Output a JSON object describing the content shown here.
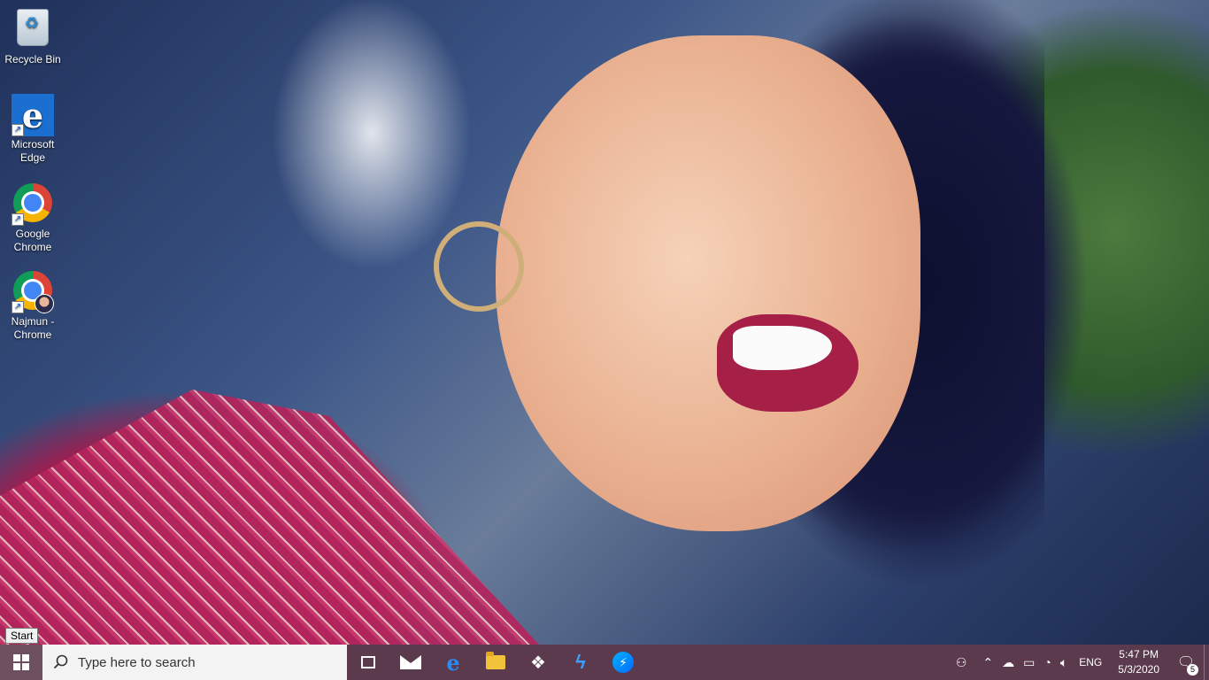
{
  "desktop": {
    "icons": [
      {
        "label": "Recycle Bin",
        "icon": "recycle-bin-icon"
      },
      {
        "label": "Microsoft Edge",
        "icon": "edge-icon"
      },
      {
        "label": "Google Chrome",
        "icon": "chrome-icon"
      },
      {
        "label": "Najmun - Chrome",
        "icon": "chrome-profile-icon"
      }
    ]
  },
  "tooltip": {
    "text": "Start"
  },
  "taskbar": {
    "search_placeholder": "Type here to search",
    "pinned": [
      {
        "name": "task-view",
        "icon": "task-view-icon"
      },
      {
        "name": "mail",
        "icon": "mail-icon"
      },
      {
        "name": "edge",
        "icon": "edge-icon"
      },
      {
        "name": "file-explorer",
        "icon": "folder-icon"
      },
      {
        "name": "dropbox",
        "icon": "dropbox-icon"
      },
      {
        "name": "app",
        "icon": "app-icon"
      },
      {
        "name": "messenger",
        "icon": "messenger-icon"
      }
    ],
    "tray": {
      "language": "ENG",
      "time": "5:47 PM",
      "date": "5/3/2020",
      "notification_count": "5"
    }
  },
  "colors": {
    "taskbar": "#5a3a4c",
    "search_bg": "#f3f3f3"
  }
}
